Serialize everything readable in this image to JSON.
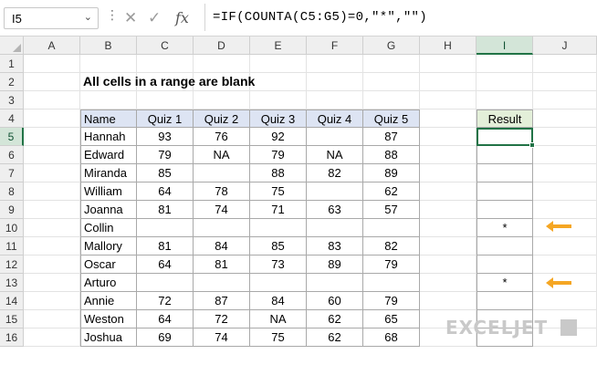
{
  "namebox": {
    "value": "I5"
  },
  "formula_bar": {
    "formula": "=IF(COUNTA(C5:G5)=0,\"*\",\"\")",
    "icons": [
      "chevron-down-icon",
      "more-options-icon",
      "cancel-icon",
      "enter-icon",
      "function-icon"
    ]
  },
  "columns": [
    "A",
    "B",
    "C",
    "D",
    "E",
    "F",
    "G",
    "H",
    "I",
    "J"
  ],
  "rows": [
    "1",
    "2",
    "3",
    "4",
    "5",
    "6",
    "7",
    "8",
    "9",
    "10",
    "11",
    "12",
    "13",
    "14",
    "15",
    "16"
  ],
  "selected_cell": {
    "column": "I",
    "row": "5"
  },
  "sheet": {
    "title": "All cells in a range are blank",
    "headers": [
      "Name",
      "Quiz 1",
      "Quiz 2",
      "Quiz 3",
      "Quiz 4",
      "Quiz 5"
    ],
    "result_header": "Result",
    "data": [
      {
        "name": "Hannah",
        "q": [
          "93",
          "76",
          "92",
          "",
          "87"
        ],
        "result": ""
      },
      {
        "name": "Edward",
        "q": [
          "79",
          "NA",
          "79",
          "NA",
          "88"
        ],
        "result": ""
      },
      {
        "name": "Miranda",
        "q": [
          "85",
          "",
          "88",
          "82",
          "89"
        ],
        "result": ""
      },
      {
        "name": "William",
        "q": [
          "64",
          "78",
          "75",
          "",
          "62"
        ],
        "result": ""
      },
      {
        "name": "Joanna",
        "q": [
          "81",
          "74",
          "71",
          "63",
          "57"
        ],
        "result": ""
      },
      {
        "name": "Collin",
        "q": [
          "",
          "",
          "",
          "",
          ""
        ],
        "result": "*"
      },
      {
        "name": "Mallory",
        "q": [
          "81",
          "84",
          "85",
          "83",
          "82"
        ],
        "result": ""
      },
      {
        "name": "Oscar",
        "q": [
          "64",
          "81",
          "73",
          "89",
          "79"
        ],
        "result": ""
      },
      {
        "name": "Arturo",
        "q": [
          "",
          "",
          "",
          "",
          ""
        ],
        "result": "*"
      },
      {
        "name": "Annie",
        "q": [
          "72",
          "87",
          "84",
          "60",
          "79"
        ],
        "result": ""
      },
      {
        "name": "Weston",
        "q": [
          "64",
          "72",
          "NA",
          "62",
          "65"
        ],
        "result": ""
      },
      {
        "name": "Joshua",
        "q": [
          "69",
          "74",
          "75",
          "62",
          "68"
        ],
        "result": ""
      }
    ]
  },
  "colors": {
    "header_fill": "#dde4f3",
    "result_header_fill": "#e3efd9",
    "selection": "#217346",
    "arrow": "#f5a623"
  },
  "watermark": {
    "text": "EXCELJET"
  }
}
